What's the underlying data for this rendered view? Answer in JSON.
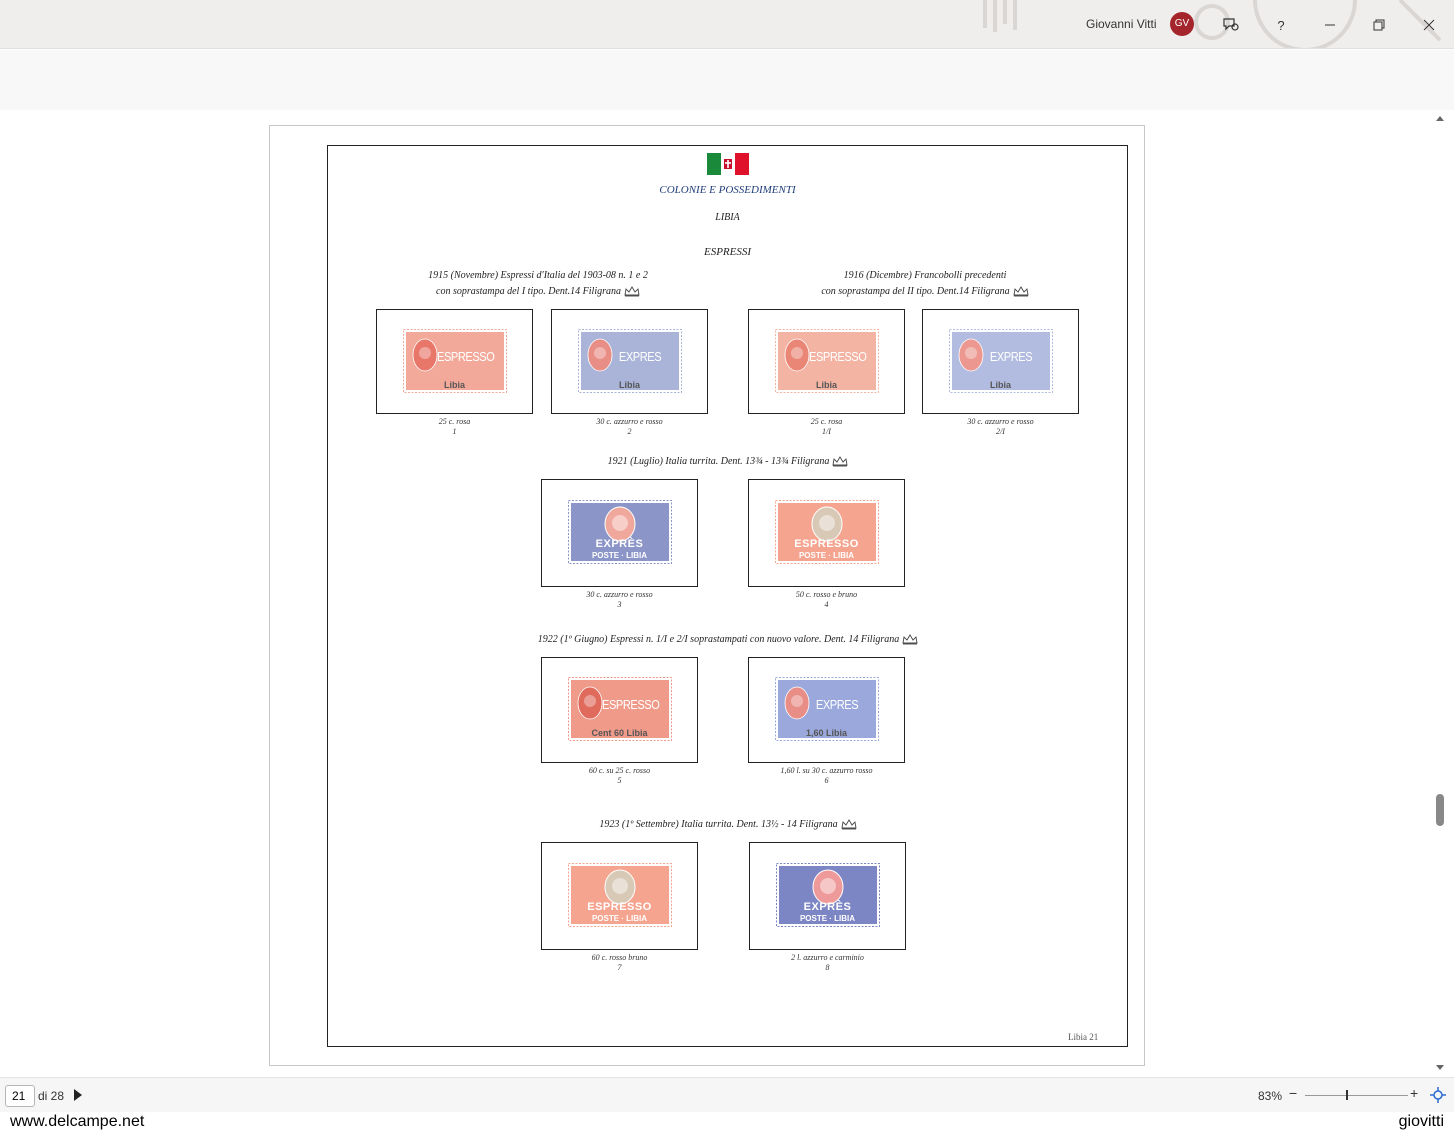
{
  "titlebar": {
    "user_name": "Giovanni Vitti",
    "avatar_initials": "GV",
    "avatar_color": "#a4262c",
    "icons": [
      "feedback-icon",
      "help-icon",
      "minimize-icon",
      "restore-icon",
      "close-icon"
    ],
    "help_label": "?"
  },
  "document": {
    "category": "COLONIE E POSSEDIMENTI",
    "country": "LIBIA",
    "section": "ESPRESSI",
    "footer": "Libia 21",
    "groups": [
      {
        "line1": "1915 (Novembre) Espressi d'Italia del 1903-08 n. 1 e 2",
        "line2": "con soprastampa del I tipo. Dent.14 Filigrana"
      },
      {
        "line1": "1916 (Dicembre) Francobolli precedenti",
        "line2": "con soprastampa del II tipo. Dent.14 Filigrana"
      },
      {
        "line1": "1921 (Luglio) Italia turrita. Dent. 13¾ - 13¾ Filigrana"
      },
      {
        "line1": "1922 (1º Giugno) Espressi n. 1/I e 2/I soprastampati con nuovo valore. Dent. 14 Filigrana"
      },
      {
        "line1": "1923 (1º Settembre) Italia turrita. Dent. 13½ - 14 Filigrana"
      }
    ],
    "stamps": [
      {
        "caption": "25 c. rosa",
        "number": "1",
        "text": "ESPRESSO",
        "overprint": "Libia",
        "color": "#f2a99a",
        "accent": "#e8776a"
      },
      {
        "caption": "30 c. azzurro e rosso",
        "number": "2",
        "text": "EXPRES",
        "overprint": "Libia",
        "color": "#a9b4d8",
        "accent": "#e88e86"
      },
      {
        "caption": "25 c. rosa",
        "number": "1/I",
        "text": "ESPRESSO",
        "overprint": "Libia",
        "color": "#f4b4a4",
        "accent": "#ea8676"
      },
      {
        "caption": "30 c. azzurro e rosso",
        "number": "2/I",
        "text": "EXPRES",
        "overprint": "Libia",
        "color": "#b2bbe0",
        "accent": "#ec9890"
      },
      {
        "caption": "30 c. azzurro e rosso",
        "number": "3",
        "text": "EXPRÈS",
        "overprint": "POSTE · LIBIA",
        "color": "#8c95c8",
        "accent": "#f0a79c"
      },
      {
        "caption": "50 c. rosso e bruno",
        "number": "4",
        "text": "ESPRESSO",
        "overprint": "POSTE · LIBIA",
        "color": "#f5a58f",
        "accent": "#d8c9b6"
      },
      {
        "caption": "60 c. su 25 c. rosso",
        "number": "5",
        "text": "ESPRESSO",
        "overprint": "Cent 60  Libia",
        "color": "#f09a8a",
        "accent": "#e06a5c"
      },
      {
        "caption": "1,60 l. su 30 c. azzurro rosso",
        "number": "6",
        "text": "EXPRES",
        "overprint": "1,60  Libia",
        "color": "#9aa8dc",
        "accent": "#e88e86"
      },
      {
        "caption": "60 c. rosso bruno",
        "number": "7",
        "text": "ESPRESSO",
        "overprint": "POSTE · LIBIA",
        "color": "#f5a58f",
        "accent": "#d8c9b6"
      },
      {
        "caption": "2 l. azzurro e carminio",
        "number": "8",
        "text": "EXPRÈS",
        "overprint": "POSTE · LIBIA",
        "color": "#7d86c4",
        "accent": "#ee9a9a"
      }
    ]
  },
  "statusbar": {
    "page_number": "21",
    "page_total": "di 28",
    "zoom": "83%",
    "zoom_minus": "−",
    "zoom_plus": "+",
    "zoom_slider_value": 0.4
  },
  "watermark": {
    "left": "www.delcampe.net",
    "right": "giovitti"
  }
}
